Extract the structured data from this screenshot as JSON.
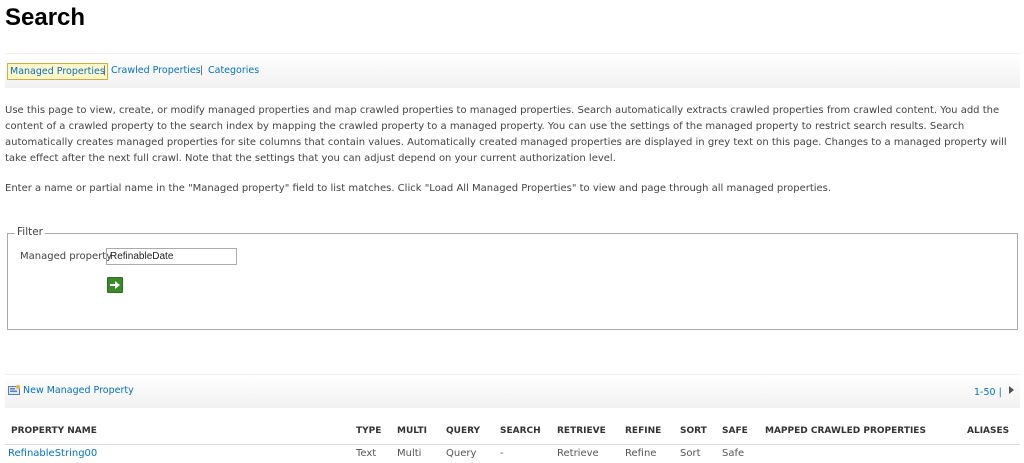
{
  "page": {
    "title": "Search"
  },
  "tabs": {
    "items": [
      {
        "label": "Managed Properties",
        "active": true
      },
      {
        "label": "Crawled Properties",
        "active": false
      },
      {
        "label": "Categories",
        "active": false
      }
    ],
    "separator": "|"
  },
  "description": {
    "paragraph1": "Use this page to view, create, or modify managed properties and map crawled properties to managed properties. Search automatically extracts crawled properties from crawled content. You add the content of a crawled property to the search index by mapping the crawled property to a managed property. You can use the settings of the managed property to restrict search results. Search automatically creates managed properties for site columns that contain values. Automatically created managed properties are displayed in grey text on this page. Changes to a managed property will take effect after the next full crawl. Note that the settings that you can adjust depend on your current authorization level.",
    "paragraph2": "Enter a name or partial name in the \"Managed property\" field to list matches. Click \"Load All Managed Properties\" to view and page through all managed properties."
  },
  "filter": {
    "legend": "Filter",
    "field_label": "Managed property",
    "field_value": "RefinableDate",
    "go_icon": "green-arrow-icon"
  },
  "toolbar": {
    "new_label": "New Managed Property",
    "new_icon": "new-property-icon",
    "paging": "1-50 |",
    "next_icon": "next-page-arrow-icon"
  },
  "table": {
    "headers": {
      "name": "PROPERTY NAME",
      "type": "TYPE",
      "multi": "MULTI",
      "query": "QUERY",
      "search": "SEARCH",
      "retrieve": "RETRIEVE",
      "refine": "REFINE",
      "sort": "SORT",
      "safe": "SAFE",
      "mapped": "MAPPED CRAWLED PROPERTIES",
      "aliases": "ALIASES"
    },
    "rows": [
      {
        "name": "RefinableString00",
        "type": "Text",
        "multi": "Multi",
        "query": "Query",
        "search": "-",
        "retrieve": "Retrieve",
        "refine": "Refine",
        "sort": "Sort",
        "safe": "Safe",
        "mapped": "",
        "aliases": ""
      }
    ]
  },
  "colors": {
    "link": "#0072c6",
    "active_tab_bg": "#fff7c8",
    "go_button": "#3a8a2a"
  }
}
